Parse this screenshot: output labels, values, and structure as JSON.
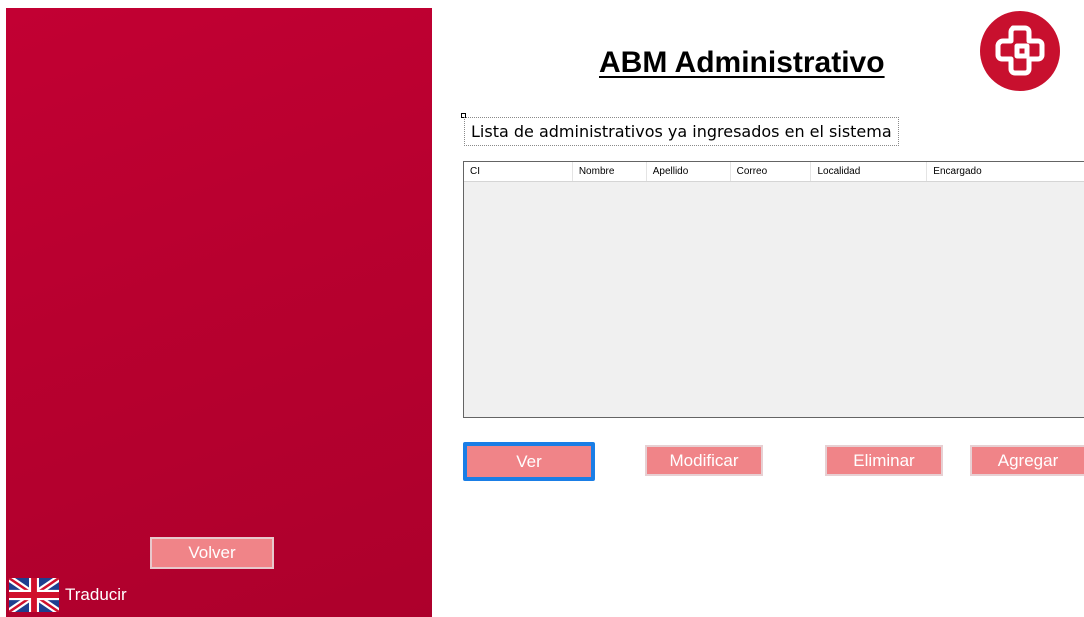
{
  "sidebar": {
    "back_button_label": "Volver",
    "translate_label": "Traducir",
    "translate_icon": "uk-flag-icon",
    "background_color": "#b8002f"
  },
  "main": {
    "title": "ABM Administrativo",
    "logo_icon": "medical-cross-logo",
    "list_label": "Lista de administrativos ya ingresados en el sistema",
    "table": {
      "columns": [
        "CI",
        "Nombre",
        "Apellido",
        "Correo",
        "Localidad",
        "Encargado"
      ],
      "rows": []
    },
    "buttons": {
      "view": "Ver",
      "modify": "Modificar",
      "delete": "Eliminar",
      "add": "Agregar"
    }
  },
  "colors": {
    "accent": "#c20033",
    "button_fill": "#f08488",
    "focus_border": "#1a7ee6"
  }
}
